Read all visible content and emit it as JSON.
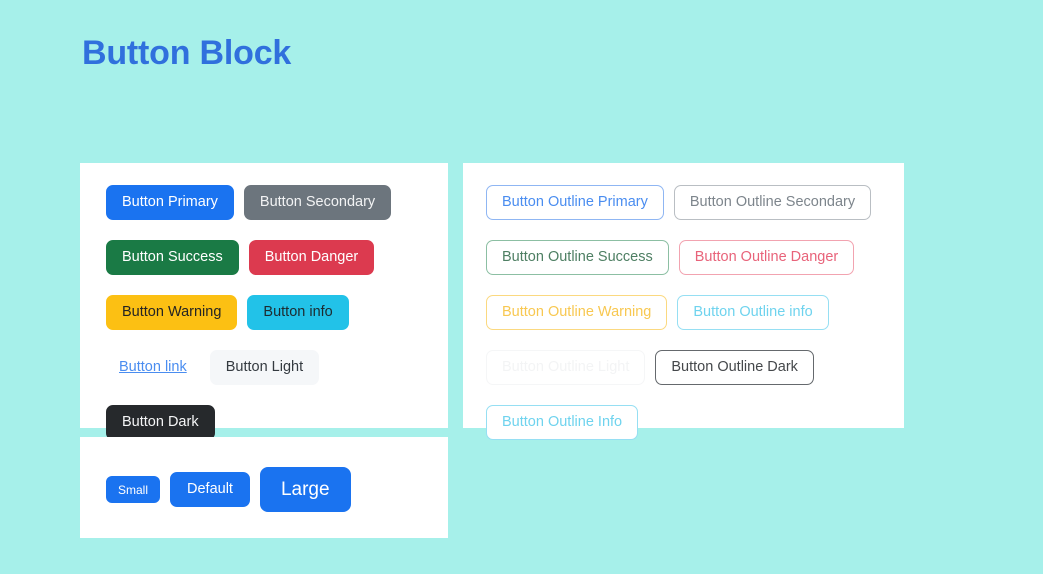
{
  "page": {
    "title": "Button Block",
    "background_color": "#a6f0ea",
    "title_color": "#3070dd",
    "card_background": "#ffffff"
  },
  "cards": {
    "solid": {
      "name": "solid-buttons-card",
      "buttons": [
        {
          "label": "Button Primary",
          "variant": "primary",
          "color": "#1a73f0",
          "text_color": "#ffffff"
        },
        {
          "label": "Button Secondary",
          "variant": "secondary",
          "color": "#6c757d",
          "text_color": "#f2f3f4"
        },
        {
          "label": "Button Success",
          "variant": "success",
          "color": "#1a7a45",
          "text_color": "#ffffff"
        },
        {
          "label": "Button Danger",
          "variant": "danger",
          "color": "#dc3a4f",
          "text_color": "#ffffff"
        },
        {
          "label": "Button Warning",
          "variant": "warning",
          "color": "#fcc013",
          "text_color": "#242424"
        },
        {
          "label": "Button info",
          "variant": "info",
          "color": "#22c2e8",
          "text_color": "#1d2b30"
        },
        {
          "label": "Button link",
          "variant": "link",
          "color": "transparent",
          "text_color": "#4a8df0"
        },
        {
          "label": "Button Light",
          "variant": "light",
          "color": "#f5f7f9",
          "text_color": "#343a40"
        },
        {
          "label": "Button Dark",
          "variant": "dark",
          "color": "#26292c",
          "text_color": "#f4f5f6"
        }
      ]
    },
    "outline": {
      "name": "outline-buttons-card",
      "buttons": [
        {
          "label": "Button Outline Primary",
          "variant": "o-primary",
          "border_color": "#8fb6f3",
          "text_color": "#4a8df0"
        },
        {
          "label": "Button Outline Secondary",
          "variant": "o-secondary",
          "border_color": "#b9bec3",
          "text_color": "#7d858c"
        },
        {
          "label": "Button Outline Success",
          "variant": "o-success",
          "border_color": "#8cbfa3",
          "text_color": "#4e7f63"
        },
        {
          "label": "Button Outline Danger",
          "variant": "o-danger",
          "border_color": "#f2a3b0",
          "text_color": "#e8637a"
        },
        {
          "label": "Button Outline Warning",
          "variant": "o-warning",
          "border_color": "#fbd980",
          "text_color": "#f8c851"
        },
        {
          "label": "Button Outline info",
          "variant": "o-info",
          "border_color": "#96dff3",
          "text_color": "#6fd3ee"
        },
        {
          "label": "Button Outline Light",
          "variant": "o-light",
          "border_color": "#f5f6f7",
          "text_color": "#f3f4f5"
        },
        {
          "label": "Button Outline Dark",
          "variant": "o-dark",
          "border_color": "#65696d",
          "text_color": "#45484b"
        },
        {
          "label": "Button Outline Info",
          "variant": "o-info",
          "border_color": "#96dff3",
          "text_color": "#6fd3ee"
        }
      ]
    },
    "sizes": {
      "name": "button-sizes-card",
      "buttons": [
        {
          "label": "Small",
          "size": "sm",
          "variant": "primary",
          "color": "#1a73f0"
        },
        {
          "label": "Default",
          "size": "md",
          "variant": "primary",
          "color": "#1a73f0"
        },
        {
          "label": "Large",
          "size": "lg",
          "variant": "primary",
          "color": "#1a73f0"
        }
      ]
    }
  }
}
